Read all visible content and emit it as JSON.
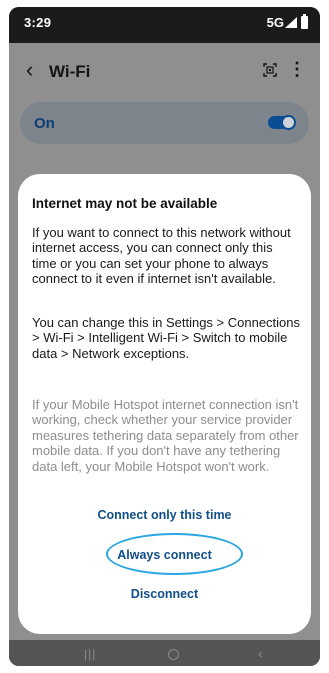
{
  "status_bar": {
    "time": "3:29",
    "network": "5G"
  },
  "app_bar": {
    "back_glyph": "‹",
    "title": "Wi-Fi",
    "more_glyph": "⋮"
  },
  "master_switch": {
    "label": "On",
    "state": "on"
  },
  "dialog": {
    "title": "Internet may not be available",
    "paragraph_1": "If you want to connect to this network without internet access, you can connect only this time or you can set your phone to always connect to it even if internet isn't available.",
    "paragraph_2": "You can change this in Settings > Connections > Wi-Fi > Intelligent Wi-Fi > Switch to mobile data > Network exceptions.",
    "paragraph_3": "If your Mobile Hotspot internet connection isn't working, check whether your service provider measures tethering data separately from other mobile data. If you don't have any tethering data left, your Mobile Hotspot won't work.",
    "buttons": {
      "connect_once": "Connect only this time",
      "always_connect": "Always connect",
      "disconnect": "Disconnect"
    }
  },
  "icons": {
    "qr": "qr-scan-icon",
    "more": "more-options-icon",
    "back": "back-arrow-icon"
  },
  "colors": {
    "accent": "#0a4d94",
    "button_text": "#114f8a",
    "highlight_circle": "#2aa6e0"
  }
}
